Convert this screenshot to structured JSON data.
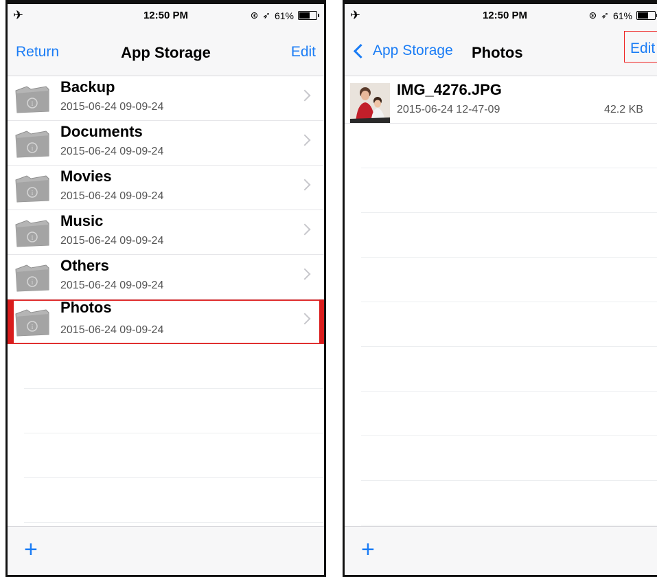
{
  "left": {
    "status": {
      "time": "12:50 PM",
      "battery": "61%",
      "battery_fraction": 0.61
    },
    "nav": {
      "left_label": "Return",
      "title": "App Storage",
      "edit_label": "Edit"
    },
    "folders": [
      {
        "name": "Backup",
        "date": "2015-06-24 09-09-24"
      },
      {
        "name": "Documents",
        "date": "2015-06-24 09-09-24"
      },
      {
        "name": "Movies",
        "date": "2015-06-24 09-09-24"
      },
      {
        "name": "Music",
        "date": "2015-06-24 09-09-24"
      },
      {
        "name": "Others",
        "date": "2015-06-24 09-09-24"
      },
      {
        "name": "Photos",
        "date": "2015-06-24 09-09-24"
      }
    ],
    "toolbar": {
      "add_label": "+"
    }
  },
  "right": {
    "status": {
      "time": "12:50 PM",
      "battery": "61%",
      "battery_fraction": 0.61
    },
    "nav": {
      "back_label": "App Storage",
      "title": "Photos",
      "edit_label": "Edit"
    },
    "files": [
      {
        "name": "IMG_4276.JPG",
        "date": "2015-06-24 12-47-09",
        "size": "42.2 KB"
      }
    ],
    "toolbar": {
      "add_label": "+"
    }
  },
  "colors": {
    "accent": "#1a7cf5",
    "highlight": "#e03030"
  }
}
